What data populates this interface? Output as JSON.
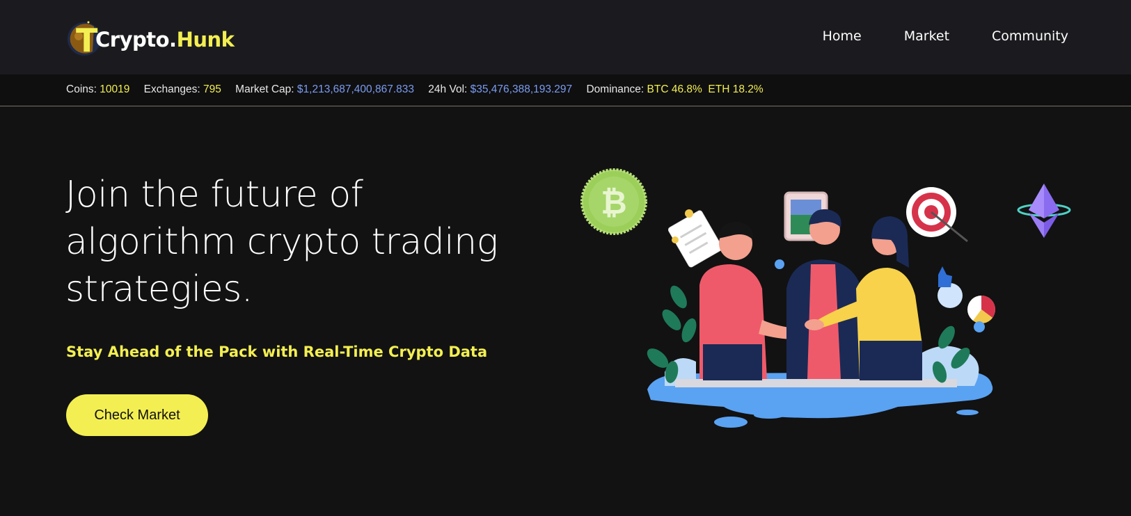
{
  "brand": {
    "logo_letter": "T",
    "name_part1": "Crypto.",
    "name_part2": "Hunk",
    "accent_color": "#f3ef52"
  },
  "nav": {
    "items": [
      {
        "label": "Home"
      },
      {
        "label": "Market"
      },
      {
        "label": "Community"
      }
    ]
  },
  "ticker": {
    "coins_label": "Coins:",
    "coins_value": "10019",
    "exchanges_label": "Exchanges:",
    "exchanges_value": "795",
    "market_cap_label": "Market Cap:",
    "market_cap_value": "$1,213,687,400,867.833",
    "vol_label": "24h Vol:",
    "vol_value": "$35,476,388,193.297",
    "dominance_label": "Dominance:",
    "btc_dominance": "BTC 46.8%",
    "eth_dominance": "ETH 18.2%"
  },
  "hero": {
    "title_line1": "Join the future of",
    "title_line2": "algorithm crypto trading",
    "title_line3": "strategies.",
    "subtitle": "Stay Ahead of the Pack with Real-Time Crypto Data",
    "cta_label": "Check Market"
  },
  "icons": {
    "bitcoin": "bitcoin-coin-icon",
    "ethereum": "ethereum-icon",
    "illustration": "team-handshake-illustration"
  }
}
